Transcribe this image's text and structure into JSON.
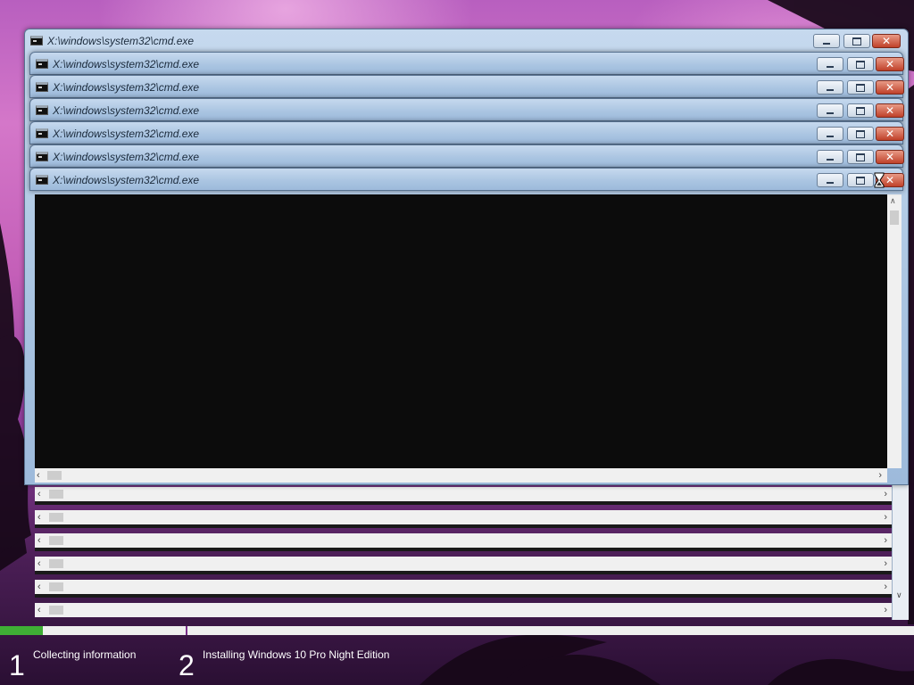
{
  "desktop": {
    "colors": {
      "sky_top": "#b85fbf",
      "sky_bottom": "#2a0f33"
    }
  },
  "cursor": {
    "icon": "hourglass-busy-icon"
  },
  "windows": [
    {
      "title": "X:\\windows\\system32\\cmd.exe",
      "icon": "command-prompt-icon"
    },
    {
      "title": "X:\\windows\\system32\\cmd.exe",
      "icon": "command-prompt-icon"
    },
    {
      "title": "X:\\windows\\system32\\cmd.exe",
      "icon": "command-prompt-icon"
    },
    {
      "title": "X:\\windows\\system32\\cmd.exe",
      "icon": "command-prompt-icon"
    },
    {
      "title": "X:\\windows\\system32\\cmd.exe",
      "icon": "command-prompt-icon"
    },
    {
      "title": "X:\\windows\\system32\\cmd.exe",
      "icon": "command-prompt-icon"
    },
    {
      "title": "X:\\windows\\system32\\cmd.exe",
      "icon": "command-prompt-icon"
    }
  ],
  "window_controls": {
    "minimize_icon": "minimize-icon",
    "maximize_icon": "maximize-icon",
    "close_icon": "close-icon",
    "close_color": "#c0412a"
  },
  "setup": {
    "progress": {
      "fraction_complete": 0.047,
      "fill_color": "#3fae35"
    },
    "steps": [
      {
        "number": "1",
        "label": "Collecting information"
      },
      {
        "number": "2",
        "label": "Installing Windows 10 Pro Night Edition"
      }
    ]
  }
}
